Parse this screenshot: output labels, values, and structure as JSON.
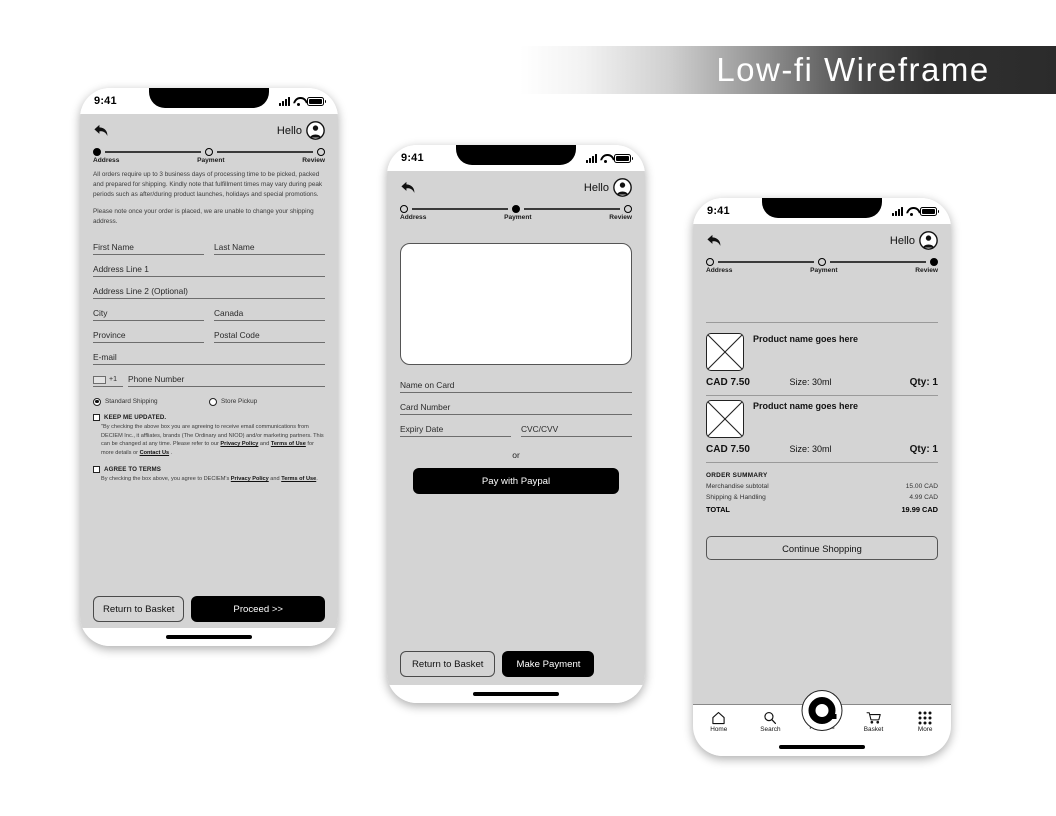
{
  "banner": {
    "title": "Low-fi Wireframe"
  },
  "status_bar": {
    "time": "9:41",
    "signal_icon": "cellular-bars-icon",
    "wifi_icon": "wifi-icon",
    "battery_icon": "battery-full-icon"
  },
  "header": {
    "back_icon": "back-arrow-icon",
    "greeting": "Hello",
    "avatar_icon": "user-avatar-icon"
  },
  "stepper": {
    "steps": [
      {
        "label": "Address"
      },
      {
        "label": "Payment"
      },
      {
        "label": "Review"
      }
    ]
  },
  "screen_address": {
    "notice_1": "All orders require up to 3 business days of processing time to be picked, packed and prepared for shipping. Kindly note that fulfillment times may vary during peak periods such as after/during product launches, holidays and special promotions.",
    "notice_2": "Please note once your order is placed, we are unable to change your shipping address.",
    "fields": {
      "first_name": "First Name",
      "last_name": "Last Name",
      "address_1": "Address Line 1",
      "address_2": "Address Line 2 (Optional)",
      "city": "City",
      "country": "Canada",
      "province": "Province",
      "postal_code": "Postal Code",
      "email": "E-mail",
      "country_code": "+1",
      "phone": "Phone Number"
    },
    "shipping_options": [
      {
        "label": "Standard Shipping",
        "selected": true
      },
      {
        "label": "Store Pickup",
        "selected": false
      }
    ],
    "keep_updated": {
      "title": "KEEP ME UPDATED.",
      "text_a": "\"By checking the above box you are agreeing to receive email communications from DECIEM Inc., it affliates, brands (The Ordinary and NIOD) and/or marketing partners. This can be changed at any time. Please refer to our ",
      "link_1": "Privacy Policy",
      "text_b": " and ",
      "link_2": "Terms of Use",
      "text_c": " for more details or ",
      "link_3": "Contact Us",
      "text_d": " ."
    },
    "agree_terms": {
      "title": "AGREE TO TERMS",
      "text_a": "By checking the box above, you agree to DECIEM's ",
      "link_1": "Privacy Policy",
      "text_b": " and ",
      "link_2": "Terms of Use",
      "text_c": "."
    },
    "buttons": {
      "secondary": "Return to Basket",
      "primary": "Proceed >>"
    }
  },
  "screen_payment": {
    "card_preview": "card-preview-placeholder",
    "fields": {
      "name_on_card": "Name on Card",
      "card_number": "Card Number",
      "expiry_date": "Expiry Date",
      "cvc": "CVC/CVV"
    },
    "or_label": "or",
    "paypal_button": "Pay with Paypal",
    "buttons": {
      "secondary": "Return to Basket",
      "primary": "Make Payment"
    }
  },
  "screen_review": {
    "products": [
      {
        "name": "Product name goes here",
        "price": "CAD 7.50",
        "size": "Size: 30ml",
        "qty": "Qty: 1",
        "thumb_icon": "image-placeholder-icon"
      },
      {
        "name": "Product name goes here",
        "price": "CAD 7.50",
        "size": "Size: 30ml",
        "qty": "Qty: 1",
        "thumb_icon": "image-placeholder-icon"
      }
    ],
    "summary": {
      "title": "ORDER SUMMARY",
      "lines": [
        {
          "label": "Merchandise subtotal",
          "value": "15.00 CAD"
        },
        {
          "label": "Shipping & Handling",
          "value": "4.99 CAD"
        }
      ],
      "total_label": "TOTAL",
      "total_value": "19.99 CAD"
    },
    "continue_button": "Continue Shopping",
    "tabbar": [
      {
        "label": "Home",
        "icon": "home-icon"
      },
      {
        "label": "Search",
        "icon": "search-icon"
      },
      {
        "label": "Products",
        "icon": "products-ring-icon"
      },
      {
        "label": "Basket",
        "icon": "shopping-cart-icon"
      },
      {
        "label": "More",
        "icon": "grid-dots-icon"
      }
    ]
  },
  "colors": {
    "screen_bg": "#d4d4d4",
    "accent_dark": "#000000",
    "line": "#6d6d6d"
  }
}
